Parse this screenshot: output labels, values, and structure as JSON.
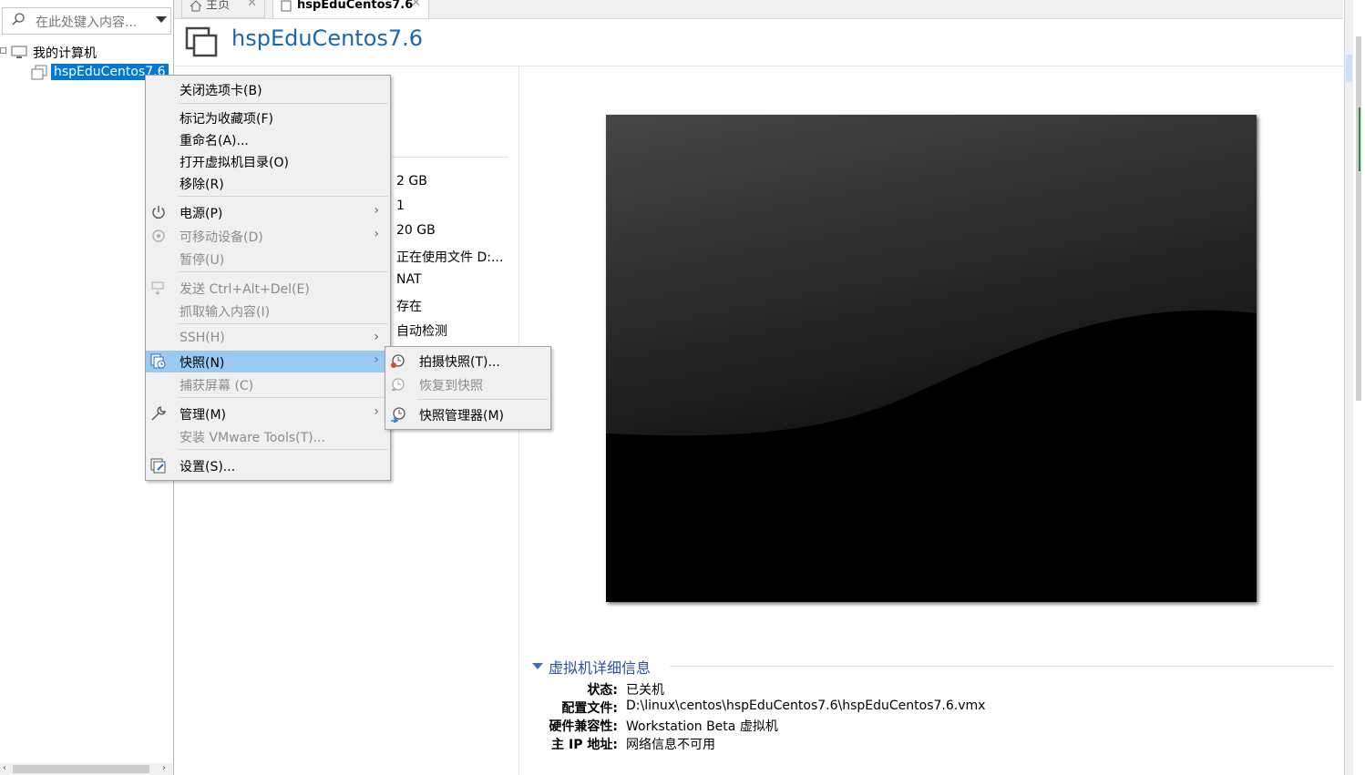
{
  "search": {
    "placeholder": "在此处键入内容..."
  },
  "tree": {
    "root_label": "我的计算机",
    "vm_label": "hspEduCentos7.6"
  },
  "tabs": [
    {
      "label": "主页"
    },
    {
      "label": "hspEduCentos7.6"
    }
  ],
  "header": {
    "title": "hspEduCentos7.6"
  },
  "devices": [
    "2 GB",
    "1",
    "20 GB",
    "正在使用文件 D:...",
    "NAT",
    "存在",
    "自动检测"
  ],
  "context_menu": {
    "items": [
      {
        "label": "关闭选项卡(B)",
        "enabled": true
      },
      {
        "label": "标记为收藏项(F)",
        "enabled": true
      },
      {
        "label": "重命名(A)...",
        "enabled": true
      },
      {
        "label": "打开虚拟机目录(O)",
        "enabled": true
      },
      {
        "label": "移除(R)",
        "enabled": true
      },
      {
        "label": "电源(P)",
        "enabled": true,
        "submenu": true,
        "icon": "power-icon"
      },
      {
        "label": "可移动设备(D)",
        "enabled": false,
        "submenu": true,
        "icon": "removable-device-icon"
      },
      {
        "label": "暂停(U)",
        "enabled": false
      },
      {
        "label": "发送 Ctrl+Alt+Del(E)",
        "enabled": false,
        "icon": "send-keys-icon"
      },
      {
        "label": "抓取输入内容(I)",
        "enabled": false
      },
      {
        "label": "SSH(H)",
        "enabled": false,
        "submenu": true
      },
      {
        "label": "快照(N)",
        "enabled": true,
        "submenu": true,
        "highlighted": true,
        "icon": "snapshot-icon"
      },
      {
        "label": "捕获屏幕 (C)",
        "enabled": false
      },
      {
        "label": "管理(M)",
        "enabled": true,
        "submenu": true,
        "icon": "wrench-icon"
      },
      {
        "label": "安装 VMware Tools(T)...",
        "enabled": false
      },
      {
        "label": "设置(S)...",
        "enabled": true,
        "icon": "settings-icon"
      }
    ]
  },
  "snapshot_menu": {
    "items": [
      {
        "label": "拍摄快照(T)...",
        "enabled": true,
        "icon": "take-snapshot-icon"
      },
      {
        "label": "恢复到快照",
        "enabled": false,
        "icon": "revert-snapshot-icon"
      },
      {
        "label": "快照管理器(M)",
        "enabled": true,
        "icon": "snapshot-manager-icon"
      }
    ]
  },
  "details": {
    "title": "虚拟机详细信息",
    "rows": [
      {
        "label": "状态:",
        "value": "已关机"
      },
      {
        "label": "配置文件:",
        "value": "D:\\linux\\centos\\hspEduCentos7.6\\hspEduCentos7.6.vmx"
      },
      {
        "label": "硬件兼容性:",
        "value": "Workstation Beta 虚拟机"
      },
      {
        "label": "主 IP 地址:",
        "value": "网络信息不可用"
      }
    ]
  },
  "colors": {
    "accent": "#0078d7",
    "title_blue": "#1a66b3",
    "menu_highlight": "#9ac9f2"
  }
}
